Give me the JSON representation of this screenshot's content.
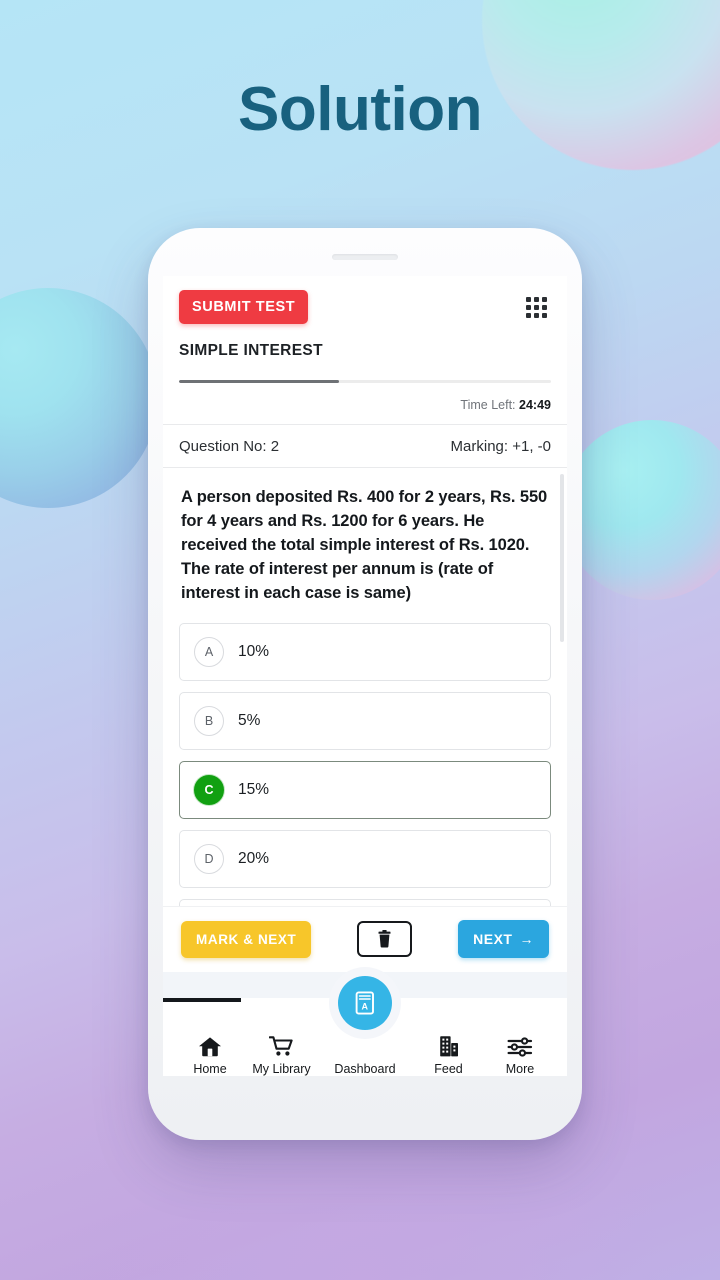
{
  "page": {
    "headline": "Solution"
  },
  "app": {
    "header": {
      "submit_label": "SUBMIT TEST",
      "grid_icon": "apps-grid-icon",
      "test_title": "SIMPLE INTEREST",
      "progress_percent": 43,
      "time_left_label": "Time Left:",
      "time_left_value": "24:49"
    },
    "meta": {
      "question_no": "Question No: 2",
      "marking": "Marking: +1, -0"
    },
    "question": {
      "text": "A person deposited Rs. 400 for 2 years, Rs. 550 for 4 years and Rs. 1200 for 6 years. He received the total simple interest of Rs. 1020. The rate of interest per annum is (rate of interest in each case is same)"
    },
    "options": [
      {
        "badge": "A",
        "text": "10%",
        "state": "normal"
      },
      {
        "badge": "B",
        "text": "5%",
        "state": "normal"
      },
      {
        "badge": "C",
        "text": "15%",
        "state": "correct"
      },
      {
        "badge": "D",
        "text": "20%",
        "state": "normal"
      }
    ],
    "actions": {
      "mark_next_label": "MARK & NEXT",
      "clear_icon": "trash-icon",
      "next_label": "NEXT",
      "next_arrow": "→"
    },
    "bottom_nav": {
      "items": [
        {
          "label": "Home",
          "icon": "home-icon"
        },
        {
          "label": "My Library",
          "icon": "cart-icon"
        },
        {
          "label": "Dashboard",
          "icon": "book-a-icon"
        },
        {
          "label": "Feed",
          "icon": "building-icon"
        },
        {
          "label": "More",
          "icon": "sliders-icon"
        }
      ]
    }
  },
  "colors": {
    "submit_red": "#ef3b42",
    "mark_yellow": "#f7c62a",
    "next_blue": "#2ba6df",
    "correct_green": "#11a011",
    "fab_cyan": "#35b5e6",
    "headline": "#18617f"
  }
}
